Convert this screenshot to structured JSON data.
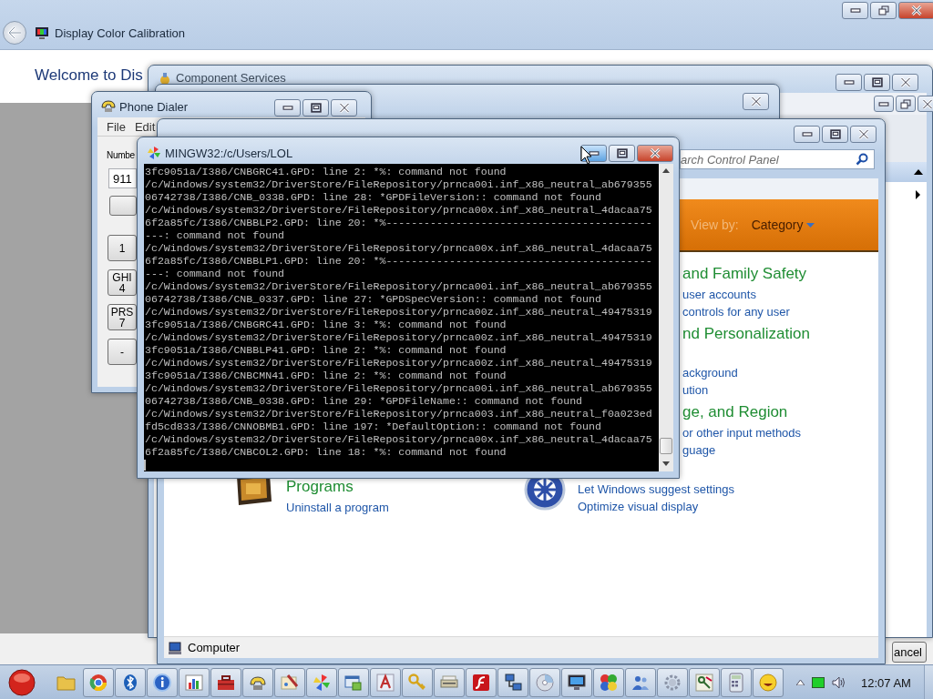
{
  "calibration_window": {
    "title": "Display Color Calibration",
    "heading": "Welcome to Dis",
    "cancel_button": "ancel"
  },
  "component_services": {
    "title": "Component Services"
  },
  "phone_dialer": {
    "title": "Phone Dialer",
    "menu": [
      "File",
      "Edit"
    ],
    "number_label": "Numbe",
    "number_value": "911",
    "keys": [
      {
        "digit": "1"
      },
      {
        "letters": "GHI",
        "digit": "4"
      },
      {
        "letters": "PRS",
        "digit": "7"
      },
      {
        "digit": "-"
      }
    ]
  },
  "terminal": {
    "title": "MINGW32:/c/Users/LOL",
    "lines": [
      "3fc9051a/I386/CNBGRC41.GPD: line 2: *%: command not found",
      "/c/Windows/system32/DriverStore/FileRepository/prnca00i.inf_x86_neutral_ab679355",
      "06742738/I386/CNB_0338.GPD: line 28: *GPDFileVersion:: command not found",
      "/c/Windows/system32/DriverStore/FileRepository/prnca00x.inf_x86_neutral_4dacaa75",
      "6f2a85fc/I386/CNBBLP2.GPD: line 20: *%------------------------------------------",
      "---: command not found",
      "/c/Windows/system32/DriverStore/FileRepository/prnca00x.inf_x86_neutral_4dacaa75",
      "6f2a85fc/I386/CNBBLP1.GPD: line 20: *%------------------------------------------",
      "---: command not found",
      "/c/Windows/system32/DriverStore/FileRepository/prnca00i.inf_x86_neutral_ab679355",
      "06742738/I386/CNB_0337.GPD: line 27: *GPDSpecVersion:: command not found",
      "/c/Windows/system32/DriverStore/FileRepository/prnca00z.inf_x86_neutral_49475319",
      "3fc9051a/I386/CNBGRC41.GPD: line 3: *%: command not found",
      "/c/Windows/system32/DriverStore/FileRepository/prnca00z.inf_x86_neutral_49475319",
      "3fc9051a/I386/CNBBLP41.GPD: line 2: *%: command not found",
      "/c/Windows/system32/DriverStore/FileRepository/prnca00z.inf_x86_neutral_49475319",
      "3fc9051a/I386/CNBCMN41.GPD: line 2: *%: command not found",
      "/c/Windows/system32/DriverStore/FileRepository/prnca00i.inf_x86_neutral_ab679355",
      "06742738/I386/CNB_0338.GPD: line 29: *GPDFileName:: command not found",
      "/c/Windows/system32/DriverStore/FileRepository/prnca003.inf_x86_neutral_f0a023ed",
      "fd5cd833/I386/CNNOBMB1.GPD: line 197: *DefaultOption:: command not found",
      "/c/Windows/system32/DriverStore/FileRepository/prnca00x.inf_x86_neutral_4dacaa75",
      "6f2a85fc/I386/CNBCOL2.GPD: line 18: *%: command not found"
    ]
  },
  "control_panel": {
    "search_placeholder": "arch Control Panel",
    "view_by_label": "View by:",
    "view_by_value": "Category",
    "categories": [
      {
        "heading": "and Family Safety",
        "links": [
          "user accounts",
          "controls for any user"
        ]
      },
      {
        "heading": "nd Personalization",
        "links": [
          "ackground",
          "ution"
        ]
      },
      {
        "heading": "ge, and Region",
        "links": [
          "or other input methods",
          "guage"
        ]
      }
    ],
    "programs": {
      "heading": "Programs",
      "links": [
        "Uninstall a program"
      ]
    },
    "display": {
      "links": [
        "Let Windows suggest settings",
        "Optimize visual display"
      ]
    },
    "status": "Computer"
  },
  "taskbar": {
    "apps": [
      {
        "kind": "folder",
        "running": false
      },
      {
        "kind": "browser",
        "running": true
      },
      {
        "kind": "bluetooth",
        "running": true
      },
      {
        "kind": "info",
        "running": true
      },
      {
        "kind": "chart",
        "running": true
      },
      {
        "kind": "toolbox",
        "running": true
      },
      {
        "kind": "phone",
        "running": true
      },
      {
        "kind": "paint",
        "running": true
      },
      {
        "kind": "pinwheel",
        "running": true
      },
      {
        "kind": "window",
        "running": true
      },
      {
        "kind": "font",
        "running": true
      },
      {
        "kind": "key",
        "running": true
      },
      {
        "kind": "scanner",
        "running": true
      },
      {
        "kind": "flash",
        "running": true
      },
      {
        "kind": "network",
        "running": true
      },
      {
        "kind": "disc",
        "running": true
      },
      {
        "kind": "monitor",
        "running": true
      },
      {
        "kind": "puzzle",
        "running": true
      },
      {
        "kind": "people",
        "running": true
      },
      {
        "kind": "gear",
        "running": true
      },
      {
        "kind": "keys",
        "running": true
      },
      {
        "kind": "calculator",
        "running": true
      },
      {
        "kind": "smiley",
        "running": true
      }
    ],
    "clock": "12:07 AM"
  }
}
